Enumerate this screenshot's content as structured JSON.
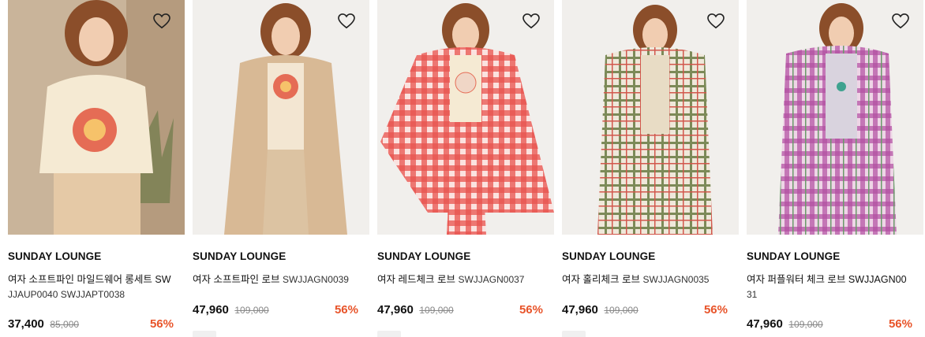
{
  "products": [
    {
      "brand": "SUNDAY LOUNGE",
      "name": "여자 소프트파인 마일드웨어 롱세트 SW",
      "code": "JJAUP0040 SWJJAPT0038",
      "price": "37,400",
      "original_price": "85,000",
      "discount": "56%"
    },
    {
      "brand": "SUNDAY LOUNGE",
      "name": "여자 소프트파인 로브",
      "code": "SWJJAGN0039",
      "price": "47,960",
      "original_price": "109,000",
      "discount": "56%"
    },
    {
      "brand": "SUNDAY LOUNGE",
      "name": "여자 레드체크 로브",
      "code": "SWJJAGN0037",
      "price": "47,960",
      "original_price": "109,000",
      "discount": "56%"
    },
    {
      "brand": "SUNDAY LOUNGE",
      "name": "여자 홀리체크 로브",
      "code": "SWJJAGN0035",
      "price": "47,960",
      "original_price": "109,000",
      "discount": "56%"
    },
    {
      "brand": "SUNDAY LOUNGE",
      "name": "여자 퍼플워터 체크 로브 SWJJAGN00",
      "code": "31",
      "price": "47,960",
      "original_price": "109,000",
      "discount": "56%"
    }
  ],
  "icons": {
    "wishlist": "heart-outline-icon"
  },
  "colors": {
    "discount": "#e8542a",
    "text": "#111111",
    "strike": "#888888"
  }
}
